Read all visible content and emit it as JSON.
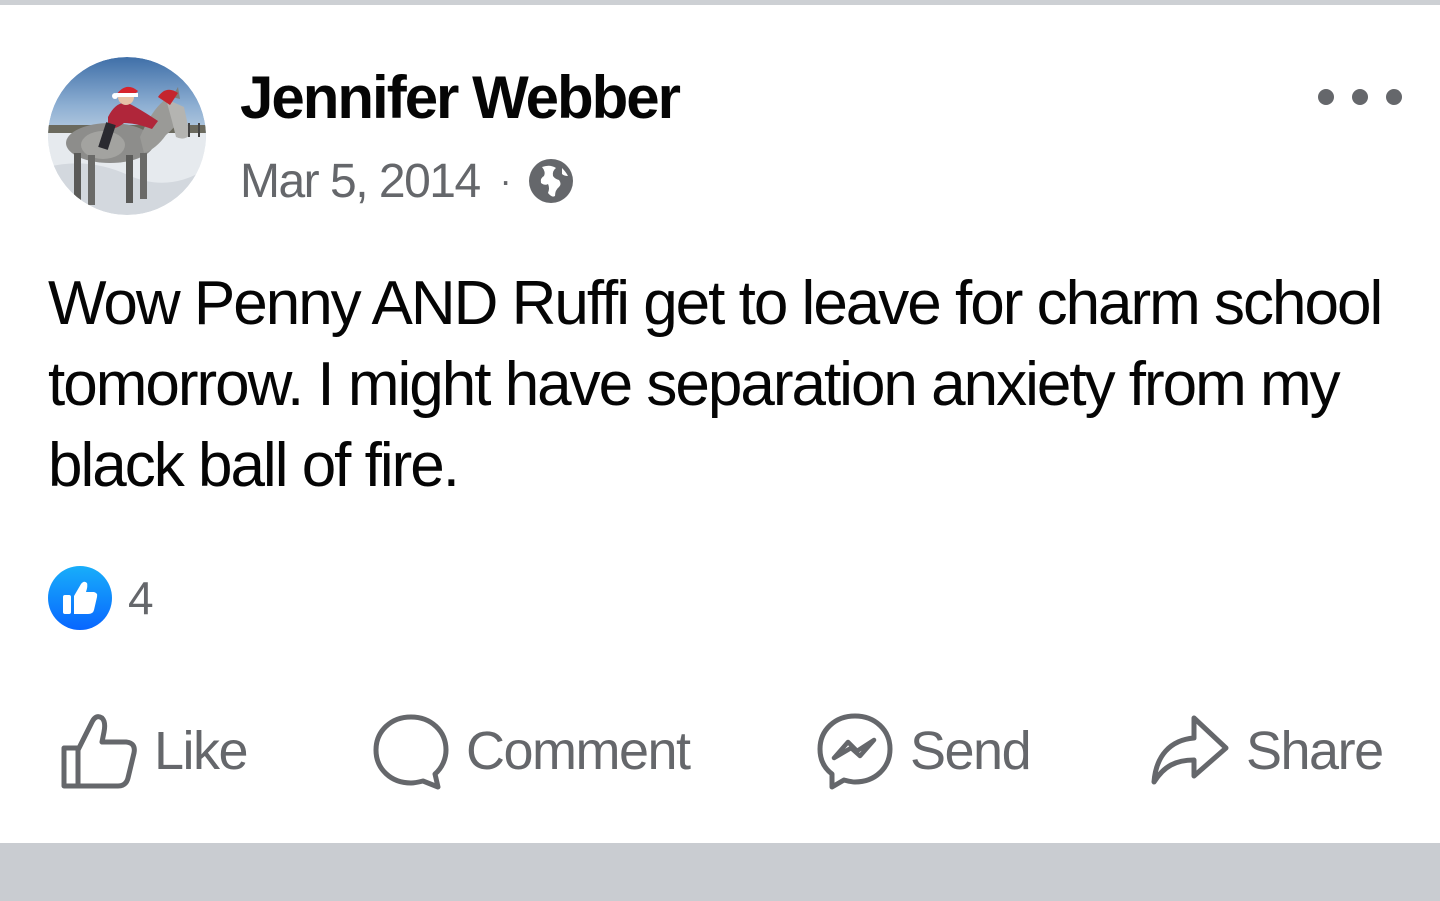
{
  "post": {
    "author_name": "Jennifer Webber",
    "timestamp": "Mar 5, 2014",
    "separator": "·",
    "audience_icon": "globe-icon",
    "text": "Wow Penny AND Ruffi get to leave for charm school tomorrow. I might have separation anxiety from my black ball of fire.",
    "reactions": {
      "icon": "like-reaction-icon",
      "count": "4"
    }
  },
  "actions": {
    "like_label": "Like",
    "comment_label": "Comment",
    "send_label": "Send",
    "share_label": "Share"
  },
  "colors": {
    "text_primary": "#050505",
    "text_secondary": "#65676b",
    "like_blue": "#1877f2",
    "divider_gray": "#c9ccd1"
  }
}
